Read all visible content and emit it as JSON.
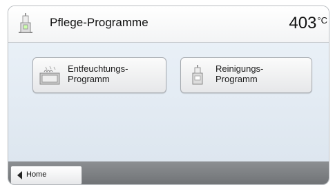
{
  "header": {
    "title": "Pflege-Programme",
    "temperature": "403",
    "unit": "°C",
    "icon": "furnace-icon"
  },
  "programs": [
    {
      "label": "Entfeuchtungs-\nProgramm",
      "icon": "dehumidify-program-icon"
    },
    {
      "label": "Reinigungs-\nProgramm",
      "icon": "cleaning-program-icon"
    }
  ],
  "footer": {
    "home_label": "Home",
    "home_icon": "back-arrow-icon"
  },
  "colors": {
    "content_bg": "#e3ebf3",
    "footer_bg": "#7d8083"
  }
}
